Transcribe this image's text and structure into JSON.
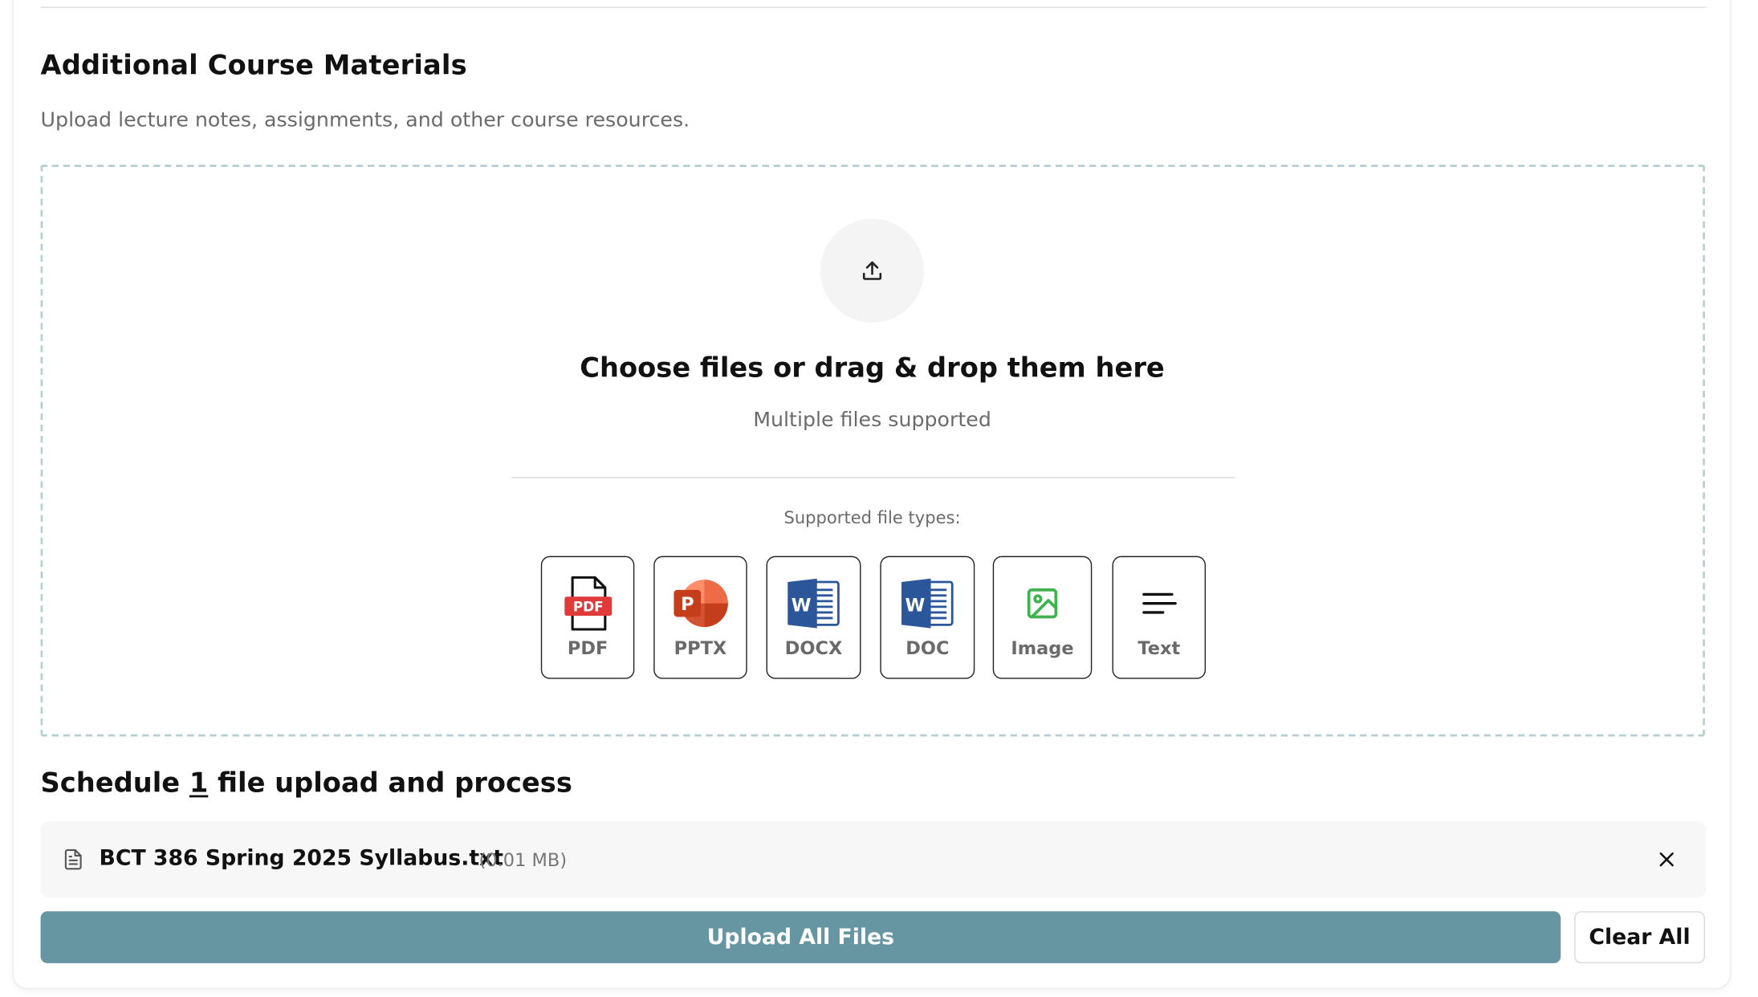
{
  "section": {
    "title": "Additional Course Materials",
    "subtitle": "Upload lecture notes, assignments, and other course resources."
  },
  "dropzone": {
    "icon": "upload-icon",
    "title": "Choose files or drag & drop them here",
    "subtitle": "Multiple files supported",
    "types_label": "Supported file types:",
    "file_types": [
      {
        "label": "PDF",
        "icon": "pdf-icon"
      },
      {
        "label": "PPTX",
        "icon": "powerpoint-icon"
      },
      {
        "label": "DOCX",
        "icon": "word-icon"
      },
      {
        "label": "DOC",
        "icon": "word-icon"
      },
      {
        "label": "Image",
        "icon": "image-icon"
      },
      {
        "label": "Text",
        "icon": "text-lines-icon"
      }
    ]
  },
  "schedule": {
    "prefix": "Schedule",
    "count": "1",
    "suffix": "file upload and process"
  },
  "files": [
    {
      "name": "BCT 386 Spring 2025 Syllabus.txt",
      "size": "(0.01 MB)",
      "icon": "document-icon",
      "remove_icon": "close-icon"
    }
  ],
  "actions": {
    "upload_all": "Upload All Files",
    "clear_all": "Clear All"
  },
  "colors": {
    "primary_button": "#6796a3",
    "dropzone_border": "#b6cfd4",
    "pdf_red": "#e03a3a",
    "pptx_orange": "#d35230",
    "word_blue": "#2b579a",
    "image_green": "#3fb34f"
  }
}
